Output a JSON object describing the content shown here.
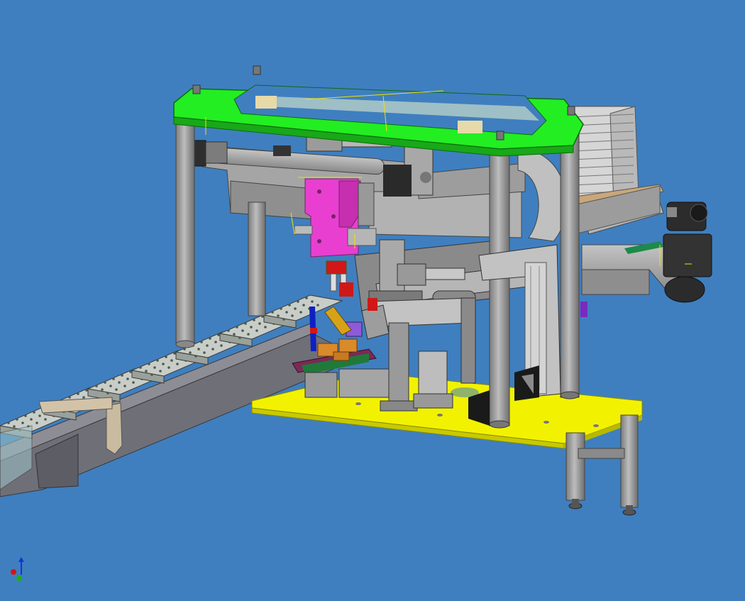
{
  "viewport": {
    "background": "#3f7fbf",
    "label_text": ""
  },
  "colors": {
    "frame_top": "#22ee22",
    "base_plate": "#f2f200",
    "tool_head": "#e83fd0",
    "conveyor": "#a8a8a8",
    "structure": "#9a9a9a",
    "fixture": "#7b2a55",
    "motor": "#2a2a2a",
    "parts": "#d98a2b",
    "accent_blue": "#1020c0",
    "accent_red": "#d01818",
    "accent_purple": "#8e5ad8",
    "gusset_black": "#1a1a1a"
  },
  "triad": {
    "icon": "axis-triad-icon",
    "x_color": "#dd1111",
    "y_color": "#22aa22",
    "z_color": "#1133dd"
  },
  "conveyor": {
    "tray_count": 7
  }
}
